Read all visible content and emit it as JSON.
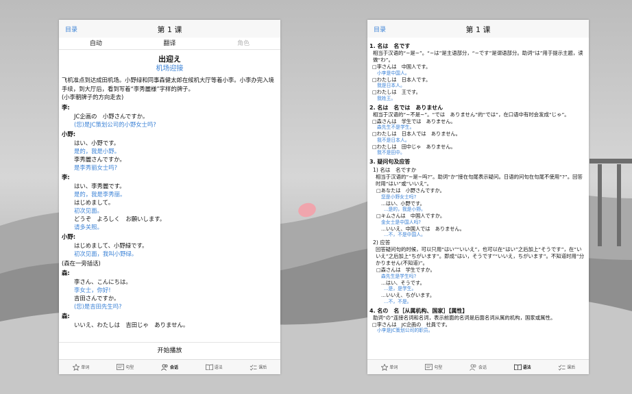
{
  "colors": {
    "accent": "#3b82d6",
    "text": "#111111",
    "disabled": "#b8b8b8"
  },
  "left": {
    "back": "目录",
    "title": "第 1 课",
    "segments": [
      {
        "label": "自动"
      },
      {
        "label": "翻译"
      },
      {
        "label": "角色"
      }
    ],
    "dialog_title": "出迎え",
    "dialog_subtitle": "机场迎接",
    "intro": "飞机准点到达成田机场。小野绿和同事森健太郎在候机大厅等着小李。小李办完入境手续，到大厅后，看到写着“李秀麗様”字样的牌子。",
    "stage1": "(小李朝牌子的方向走去)",
    "lines": [
      {
        "speaker": "李:",
        "jp": [
          "JC企画の　小野さんですか。"
        ],
        "cn": [
          "(您)是JC策划公司的小野女士吗?"
        ]
      },
      {
        "speaker": "小野:",
        "jp": [
          "はい、小野です。"
        ],
        "cn": [
          "是的，我是小野。"
        ],
        "jp2": [
          "李秀麗さんですか。"
        ],
        "cn2": [
          "是李秀丽女士吗?"
        ]
      },
      {
        "speaker": "李:",
        "jp": [
          "はい、李秀麗です。"
        ],
        "cn": [
          "是的，我是李秀丽。"
        ],
        "jp2": [
          "はじめまして。"
        ],
        "cn2": [
          "初次见面。"
        ],
        "jp3": [
          "どうぞ　よろしく　お願いします。"
        ],
        "cn3": [
          "请多关照。"
        ]
      },
      {
        "speaker": "小野:",
        "jp": [
          "はじめまして、小野緑です。"
        ],
        "cn": [
          "初次见面，我叫小野绿。"
        ]
      }
    ],
    "stage2": "(森在一旁插话)",
    "lines2": [
      {
        "speaker": "森:",
        "jp": [
          "李さん、こんにちは。"
        ],
        "cn": [
          "李女士，你好!"
        ],
        "jp2": [
          "吉田さんですか。"
        ],
        "cn2": [
          "(您)是吉田先生吗?"
        ]
      },
      {
        "speaker": "森:",
        "jp": [
          "いいえ、わたしは　吉田じゃ　ありません。"
        ]
      }
    ],
    "play": "开始播放"
  },
  "right": {
    "back": "目录",
    "title": "第 1 课",
    "sections": {
      "s1": {
        "heading": "1. 名は　名です",
        "desc": "相当于汉语的“~是~”。“~は”是主语部分，“~です”是谓语部分。助词“は”用于提示主题，读做“わ”。",
        "examples": [
          {
            "jp": "□李さんは　中国人です。",
            "cn": "小李是中国人。"
          },
          {
            "jp": "□わたしは　日本人です。",
            "cn": "我是日本人。"
          },
          {
            "jp": "□わたしは　王です。",
            "cn": "我姓王。"
          }
        ]
      },
      "s2": {
        "heading": "2. 名は　名では　ありません",
        "desc": "相当于汉语的“~不是~”。“では　ありません”的“では”，在口语中有时会发成“じゃ”。",
        "examples": [
          {
            "jp": "□森さんは　学生では　ありません。",
            "cn": "森先生不是学生。"
          },
          {
            "jp": "□わたしは　日本人では　ありません。",
            "cn": "我不是日本人。"
          },
          {
            "jp": "□わたしは　田中じゃ　ありません。",
            "cn": "我不是田中。"
          }
        ]
      },
      "s3": {
        "heading": "3. 疑问句及应答",
        "sub1": "1) 名は　名ですか",
        "sub1_desc": "相当于汉语的“~是~吗?”。助词“か”接在句尾表示疑问。日语的问句在句尾不使用“?”。回答时用“はい”或“いいえ”。",
        "q1": {
          "jp": "□あなたは　小野さんですか。",
          "cn": "您是小野女士吗?",
          "ans": "...はい、小野です。",
          "ansc": "...是的，我是小野。"
        },
        "q2": {
          "jp": "□キムさんは　中国人ですか。",
          "cn": "金女士是中国人吗?",
          "ans": "...いいえ、中国人では　ありません。",
          "ansc": "...不，不是中国人。"
        },
        "sub2": "2) 应答",
        "sub2_desc": "回答疑问句的时候，可以只用“はい”“いいえ”，也可以在“はい”之后加上“そうです”，在“いいえ”之后加上“ちがいます”。即成“はい，そうです”“いいえ，ちがいます”。不知道时用“分かりません(不知道)”。",
        "q3": {
          "jp": "□森さんは　学生ですか。",
          "cn": "森先生是学生吗?",
          "a1": "...はい、そうです。",
          "a1c": "...是，是学生。",
          "a2": "...いいえ、ちがいます。",
          "a2c": "...不，不是。"
        }
      },
      "s4": {
        "heading": "4. 名の　名［从属机构、国家］【属性】",
        "desc": "助词“の”连接名词和名词，表示前面的名词是后面名词从属的机构，国家或属性。",
        "ex": {
          "jp": "□李さんは　JC企画の　社員です。",
          "cn": "小李是JC策划公司的职员。"
        }
      }
    }
  },
  "tabs": [
    {
      "label": "单词",
      "icon": "star-icon"
    },
    {
      "label": "句型",
      "icon": "sentence-icon"
    },
    {
      "label": "会话",
      "icon": "people-icon"
    },
    {
      "label": "语法",
      "icon": "book-icon"
    },
    {
      "label": "课后",
      "icon": "checklist-icon"
    }
  ]
}
